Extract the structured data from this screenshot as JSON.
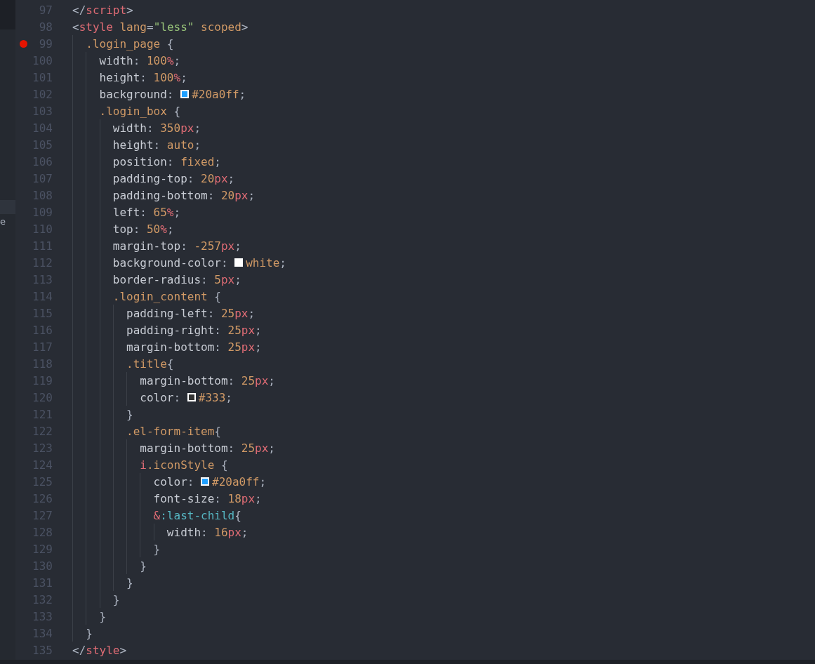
{
  "sidebar": {
    "fragment_text": "e"
  },
  "lines": [
    {
      "number": "97",
      "breakpoint": false,
      "tokens": [
        {
          "text": "</",
          "kind": "punct"
        },
        {
          "text": "script",
          "kind": "tag"
        },
        {
          "text": ">",
          "kind": "punct"
        }
      ]
    },
    {
      "number": "98",
      "breakpoint": false,
      "tokens": [
        {
          "text": "<",
          "kind": "punct"
        },
        {
          "text": "style",
          "kind": "tag"
        },
        {
          "text": " lang",
          "kind": "attr"
        },
        {
          "text": "=",
          "kind": "punct"
        },
        {
          "text": "\"less\"",
          "kind": "string"
        },
        {
          "text": " scoped",
          "kind": "attr"
        },
        {
          "text": ">",
          "kind": "punct"
        }
      ]
    },
    {
      "number": "99",
      "breakpoint": true,
      "tokens": [
        {
          "text": "  .login_page",
          "kind": "selector"
        },
        {
          "text": " {",
          "kind": "punct"
        }
      ]
    },
    {
      "number": "100",
      "breakpoint": false,
      "tokens": [
        {
          "text": "    width",
          "kind": "prop"
        },
        {
          "text": ": ",
          "kind": "punct"
        },
        {
          "text": "100",
          "kind": "num"
        },
        {
          "text": "%",
          "kind": "unit"
        },
        {
          "text": ";",
          "kind": "punct"
        }
      ]
    },
    {
      "number": "101",
      "breakpoint": false,
      "tokens": [
        {
          "text": "    height",
          "kind": "prop"
        },
        {
          "text": ": ",
          "kind": "punct"
        },
        {
          "text": "100",
          "kind": "num"
        },
        {
          "text": "%",
          "kind": "unit"
        },
        {
          "text": ";",
          "kind": "punct"
        }
      ]
    },
    {
      "number": "102",
      "breakpoint": false,
      "tokens": [
        {
          "text": "    background",
          "kind": "prop"
        },
        {
          "text": ": ",
          "kind": "punct"
        },
        {
          "kind": "swatch",
          "color": "#20a0ff"
        },
        {
          "text": "#20a0ff",
          "kind": "num"
        },
        {
          "text": ";",
          "kind": "punct"
        }
      ]
    },
    {
      "number": "103",
      "breakpoint": false,
      "tokens": [
        {
          "text": "    .login_box",
          "kind": "selector"
        },
        {
          "text": " {",
          "kind": "punct"
        }
      ]
    },
    {
      "number": "104",
      "breakpoint": false,
      "tokens": [
        {
          "text": "      width",
          "kind": "prop"
        },
        {
          "text": ": ",
          "kind": "punct"
        },
        {
          "text": "350",
          "kind": "num"
        },
        {
          "text": "px",
          "kind": "unit"
        },
        {
          "text": ";",
          "kind": "punct"
        }
      ]
    },
    {
      "number": "105",
      "breakpoint": false,
      "tokens": [
        {
          "text": "      height",
          "kind": "prop"
        },
        {
          "text": ": ",
          "kind": "punct"
        },
        {
          "text": "auto",
          "kind": "num"
        },
        {
          "text": ";",
          "kind": "punct"
        }
      ]
    },
    {
      "number": "106",
      "breakpoint": false,
      "tokens": [
        {
          "text": "      position",
          "kind": "prop"
        },
        {
          "text": ": ",
          "kind": "punct"
        },
        {
          "text": "fixed",
          "kind": "num"
        },
        {
          "text": ";",
          "kind": "punct"
        }
      ]
    },
    {
      "number": "107",
      "breakpoint": false,
      "tokens": [
        {
          "text": "      padding-top",
          "kind": "prop"
        },
        {
          "text": ": ",
          "kind": "punct"
        },
        {
          "text": "20",
          "kind": "num"
        },
        {
          "text": "px",
          "kind": "unit"
        },
        {
          "text": ";",
          "kind": "punct"
        }
      ]
    },
    {
      "number": "108",
      "breakpoint": false,
      "tokens": [
        {
          "text": "      padding-bottom",
          "kind": "prop"
        },
        {
          "text": ": ",
          "kind": "punct"
        },
        {
          "text": "20",
          "kind": "num"
        },
        {
          "text": "px",
          "kind": "unit"
        },
        {
          "text": ";",
          "kind": "punct"
        }
      ]
    },
    {
      "number": "109",
      "breakpoint": false,
      "tokens": [
        {
          "text": "      left",
          "kind": "prop"
        },
        {
          "text": ": ",
          "kind": "punct"
        },
        {
          "text": "65",
          "kind": "num"
        },
        {
          "text": "%",
          "kind": "unit"
        },
        {
          "text": ";",
          "kind": "punct"
        }
      ]
    },
    {
      "number": "110",
      "breakpoint": false,
      "tokens": [
        {
          "text": "      top",
          "kind": "prop"
        },
        {
          "text": ": ",
          "kind": "punct"
        },
        {
          "text": "50",
          "kind": "num"
        },
        {
          "text": "%",
          "kind": "unit"
        },
        {
          "text": ";",
          "kind": "punct"
        }
      ]
    },
    {
      "number": "111",
      "breakpoint": false,
      "tokens": [
        {
          "text": "      margin-top",
          "kind": "prop"
        },
        {
          "text": ": ",
          "kind": "punct"
        },
        {
          "text": "-257",
          "kind": "num"
        },
        {
          "text": "px",
          "kind": "unit"
        },
        {
          "text": ";",
          "kind": "punct"
        }
      ]
    },
    {
      "number": "112",
      "breakpoint": false,
      "tokens": [
        {
          "text": "      background-color",
          "kind": "prop"
        },
        {
          "text": ": ",
          "kind": "punct"
        },
        {
          "kind": "swatch",
          "color": "#ffffff"
        },
        {
          "text": "white",
          "kind": "num"
        },
        {
          "text": ";",
          "kind": "punct"
        }
      ]
    },
    {
      "number": "113",
      "breakpoint": false,
      "tokens": [
        {
          "text": "      border-radius",
          "kind": "prop"
        },
        {
          "text": ": ",
          "kind": "punct"
        },
        {
          "text": "5",
          "kind": "num"
        },
        {
          "text": "px",
          "kind": "unit"
        },
        {
          "text": ";",
          "kind": "punct"
        }
      ]
    },
    {
      "number": "114",
      "breakpoint": false,
      "tokens": [
        {
          "text": "      .login_content",
          "kind": "selector"
        },
        {
          "text": " {",
          "kind": "punct"
        }
      ]
    },
    {
      "number": "115",
      "breakpoint": false,
      "tokens": [
        {
          "text": "        padding-left",
          "kind": "prop"
        },
        {
          "text": ": ",
          "kind": "punct"
        },
        {
          "text": "25",
          "kind": "num"
        },
        {
          "text": "px",
          "kind": "unit"
        },
        {
          "text": ";",
          "kind": "punct"
        }
      ]
    },
    {
      "number": "116",
      "breakpoint": false,
      "tokens": [
        {
          "text": "        padding-right",
          "kind": "prop"
        },
        {
          "text": ": ",
          "kind": "punct"
        },
        {
          "text": "25",
          "kind": "num"
        },
        {
          "text": "px",
          "kind": "unit"
        },
        {
          "text": ";",
          "kind": "punct"
        }
      ]
    },
    {
      "number": "117",
      "breakpoint": false,
      "tokens": [
        {
          "text": "        margin-bottom",
          "kind": "prop"
        },
        {
          "text": ": ",
          "kind": "punct"
        },
        {
          "text": "25",
          "kind": "num"
        },
        {
          "text": "px",
          "kind": "unit"
        },
        {
          "text": ";",
          "kind": "punct"
        }
      ]
    },
    {
      "number": "118",
      "breakpoint": false,
      "tokens": [
        {
          "text": "        .title",
          "kind": "selector"
        },
        {
          "text": "{",
          "kind": "punct"
        }
      ]
    },
    {
      "number": "119",
      "breakpoint": false,
      "tokens": [
        {
          "text": "          margin-bottom",
          "kind": "prop"
        },
        {
          "text": ": ",
          "kind": "punct"
        },
        {
          "text": "25",
          "kind": "num"
        },
        {
          "text": "px",
          "kind": "unit"
        },
        {
          "text": ";",
          "kind": "punct"
        }
      ]
    },
    {
      "number": "120",
      "breakpoint": false,
      "tokens": [
        {
          "text": "          color",
          "kind": "prop"
        },
        {
          "text": ": ",
          "kind": "punct"
        },
        {
          "kind": "swatch",
          "color": "#333333"
        },
        {
          "text": "#333",
          "kind": "num"
        },
        {
          "text": ";",
          "kind": "punct"
        }
      ]
    },
    {
      "number": "121",
      "breakpoint": false,
      "tokens": [
        {
          "text": "        }",
          "kind": "punct"
        }
      ]
    },
    {
      "number": "122",
      "breakpoint": false,
      "tokens": [
        {
          "text": "        .el-form-item",
          "kind": "selector"
        },
        {
          "text": "{",
          "kind": "punct"
        }
      ]
    },
    {
      "number": "123",
      "breakpoint": false,
      "tokens": [
        {
          "text": "          margin-bottom",
          "kind": "prop"
        },
        {
          "text": ": ",
          "kind": "punct"
        },
        {
          "text": "25",
          "kind": "num"
        },
        {
          "text": "px",
          "kind": "unit"
        },
        {
          "text": ";",
          "kind": "punct"
        }
      ]
    },
    {
      "number": "124",
      "breakpoint": false,
      "tokens": [
        {
          "text": "          i",
          "kind": "tag"
        },
        {
          "text": ".iconStyle",
          "kind": "selector"
        },
        {
          "text": " {",
          "kind": "punct"
        }
      ]
    },
    {
      "number": "125",
      "breakpoint": false,
      "tokens": [
        {
          "text": "            color",
          "kind": "prop"
        },
        {
          "text": ": ",
          "kind": "punct"
        },
        {
          "kind": "swatch",
          "color": "#20a0ff"
        },
        {
          "text": "#20a0ff",
          "kind": "num"
        },
        {
          "text": ";",
          "kind": "punct"
        }
      ]
    },
    {
      "number": "126",
      "breakpoint": false,
      "tokens": [
        {
          "text": "            font-size",
          "kind": "prop"
        },
        {
          "text": ": ",
          "kind": "punct"
        },
        {
          "text": "18",
          "kind": "num"
        },
        {
          "text": "px",
          "kind": "unit"
        },
        {
          "text": ";",
          "kind": "punct"
        }
      ]
    },
    {
      "number": "127",
      "breakpoint": false,
      "tokens": [
        {
          "text": "            &",
          "kind": "tag"
        },
        {
          "text": ":last-child",
          "kind": "pseudo"
        },
        {
          "text": "{",
          "kind": "punct"
        }
      ]
    },
    {
      "number": "128",
      "breakpoint": false,
      "tokens": [
        {
          "text": "              width",
          "kind": "prop"
        },
        {
          "text": ": ",
          "kind": "punct"
        },
        {
          "text": "16",
          "kind": "num"
        },
        {
          "text": "px",
          "kind": "unit"
        },
        {
          "text": ";",
          "kind": "punct"
        }
      ]
    },
    {
      "number": "129",
      "breakpoint": false,
      "tokens": [
        {
          "text": "            }",
          "kind": "punct"
        }
      ]
    },
    {
      "number": "130",
      "breakpoint": false,
      "tokens": [
        {
          "text": "          }",
          "kind": "punct"
        }
      ]
    },
    {
      "number": "131",
      "breakpoint": false,
      "tokens": [
        {
          "text": "        }",
          "kind": "punct"
        }
      ]
    },
    {
      "number": "132",
      "breakpoint": false,
      "tokens": [
        {
          "text": "      }",
          "kind": "punct"
        }
      ]
    },
    {
      "number": "133",
      "breakpoint": false,
      "tokens": [
        {
          "text": "    }",
          "kind": "punct"
        }
      ]
    },
    {
      "number": "134",
      "breakpoint": false,
      "tokens": [
        {
          "text": "  }",
          "kind": "punct"
        }
      ]
    },
    {
      "number": "135",
      "breakpoint": false,
      "tokens": [
        {
          "text": "</",
          "kind": "punct"
        },
        {
          "text": "style",
          "kind": "tag"
        },
        {
          "text": ">",
          "kind": "punct"
        }
      ]
    }
  ]
}
